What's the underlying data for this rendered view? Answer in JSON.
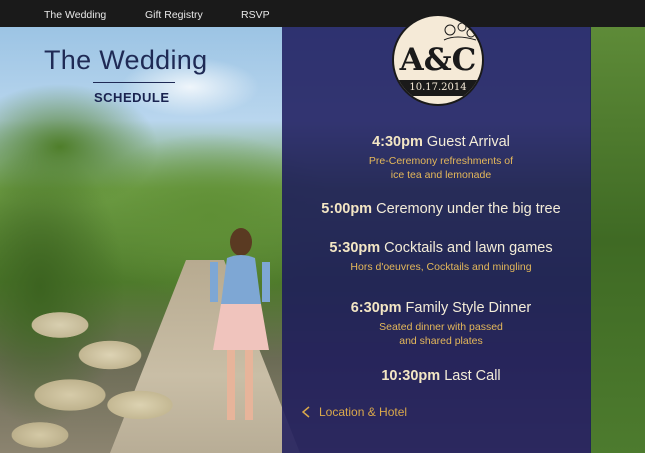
{
  "nav": {
    "items": [
      "The Wedding",
      "Gift Registry",
      "RSVP"
    ]
  },
  "header": {
    "title": "The Wedding",
    "subtitle": "SCHEDULE"
  },
  "monogram": {
    "initials": "A&C",
    "date": "10.17.2014"
  },
  "schedule": [
    {
      "time": "4:30pm",
      "title": "Guest Arrival",
      "desc_lines": [
        "Pre-Ceremony refreshments of",
        "ice tea and lemonade"
      ]
    },
    {
      "time": "5:00pm",
      "title": "Ceremony under the big tree",
      "desc_lines": []
    },
    {
      "time": "5:30pm",
      "title": "Cocktails and lawn games",
      "desc_lines": [
        "Hors d'oeuvres, Cocktails and mingling"
      ]
    },
    {
      "time": "6:30pm",
      "title": "Family Style Dinner",
      "desc_lines": [
        "Seated dinner with passed",
        "and shared plates"
      ]
    },
    {
      "time": "10:30pm",
      "title": "Last Call",
      "desc_lines": []
    }
  ],
  "footer_link": {
    "label": "Location & Hotel"
  },
  "colors": {
    "nav_bg": "#1a1a1a",
    "panel_bg": "#1c1a5c",
    "accent_gold": "#e5b85a",
    "title_navy": "#1f2a55"
  }
}
